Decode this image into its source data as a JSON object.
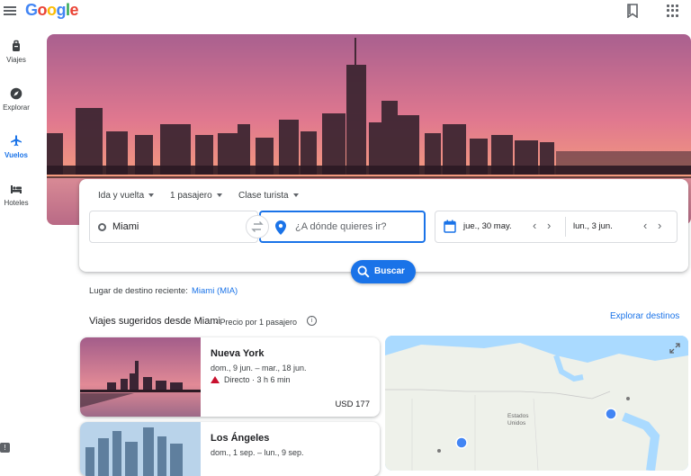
{
  "header": {
    "logo": [
      "G",
      "o",
      "o",
      "g",
      "l",
      "e"
    ]
  },
  "nav": [
    {
      "label": "Viajes"
    },
    {
      "label": "Explorar"
    },
    {
      "label": "Vuelos"
    },
    {
      "label": "Hoteles"
    }
  ],
  "search": {
    "trip_type": "Ida y vuelta",
    "passengers": "1 pasajero",
    "cabin": "Clase turista",
    "origin": "Miami",
    "destination_placeholder": "¿A dónde quieres ir?",
    "depart": "jue., 30 may.",
    "return": "lun., 3 jun.",
    "button": "Buscar"
  },
  "recent": {
    "label": "Lugar de destino reciente:",
    "link": "Miami (MIA)"
  },
  "suggestions": {
    "title": "Viajes sugeridos desde Miami",
    "subtitle": "· Precio por 1 pasajero",
    "explore": "Explorar destinos",
    "cards": [
      {
        "city": "Nueva York",
        "dates": "dom., 9 jun. – mar., 18 jun.",
        "stops": "Directo · 3 h 6 min",
        "price": "USD 177"
      },
      {
        "city": "Los Ángeles",
        "dates": "dom., 1 sep. – lun., 9 sep.",
        "stops": "",
        "price": ""
      }
    ]
  },
  "map": {
    "label": "Estados Unidos"
  },
  "colors": {
    "accent": "#1a73e8",
    "hero_sky_top": "#c86a8c",
    "hero_sky_bottom": "#f7a07a"
  }
}
